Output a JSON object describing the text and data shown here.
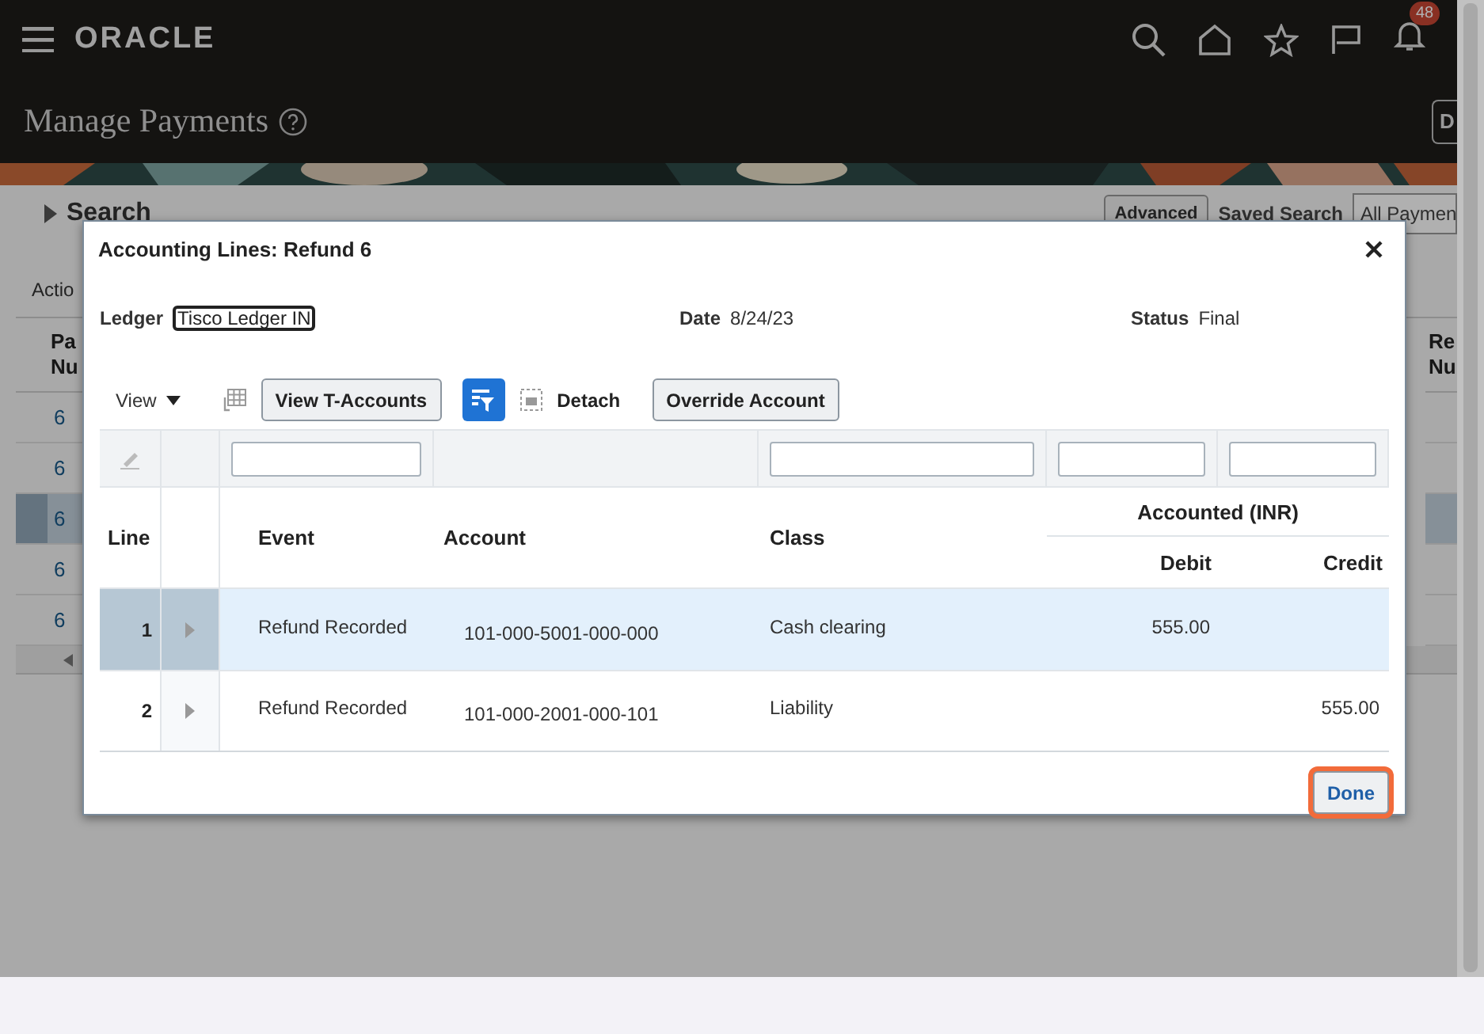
{
  "header": {
    "logo": "ORACLE",
    "notification_count": "48"
  },
  "page": {
    "title": "Manage Payments",
    "cut_button": "D",
    "search": {
      "label": "Search",
      "buttons": [
        "Advanced"
      ],
      "saved_search_label": "Saved Search",
      "saved_search_value": "All Paymen"
    },
    "actions_label": "Actio",
    "results": {
      "first_heading": [
        "Pa",
        "Nu"
      ],
      "last_heading": [
        "Re",
        "Nu"
      ],
      "rows": [
        {
          "value": "6",
          "selected": false
        },
        {
          "value": "6",
          "selected": false
        },
        {
          "value": "6",
          "selected": true
        },
        {
          "value": "6",
          "selected": false
        },
        {
          "value": "6",
          "selected": false
        }
      ]
    }
  },
  "dialog": {
    "title": "Accounting Lines: Refund 6",
    "fields": [
      {
        "label": "Ledger",
        "value": "Tisco Ledger IN",
        "kind": "link"
      },
      {
        "label": "Date",
        "value": "8/24/23",
        "kind": "text"
      },
      {
        "label": "Status",
        "value": "Final",
        "kind": "text"
      }
    ],
    "toolbar": [
      {
        "kind": "menu",
        "label": "View"
      },
      {
        "kind": "icon"
      },
      {
        "kind": "button",
        "label": "View T-Accounts"
      },
      {
        "kind": "toggle",
        "selected": true
      },
      {
        "kind": "icon-label",
        "label": "Detach"
      },
      {
        "kind": "button",
        "label": "Override Account"
      }
    ],
    "columns": [
      {
        "label": "Line",
        "filter": false
      },
      {
        "label": "Event",
        "filter": true
      },
      {
        "label": "Account",
        "filter": false
      },
      {
        "label": "Class",
        "filter": true
      }
    ],
    "amount_group": {
      "label": "Accounted (INR)",
      "columns": [
        {
          "label": "Debit",
          "filter": true
        },
        {
          "label": "Credit",
          "filter": true
        }
      ]
    },
    "rows": [
      {
        "line": "1",
        "event": "Refund Recorded",
        "account": "101-000-5001-000-000",
        "class": "Cash clearing",
        "debit": "555.00",
        "selected": true
      },
      {
        "line": "2",
        "event": "Refund Recorded",
        "account": "101-000-2001-000-101",
        "class": "Liability",
        "credit": "555.00",
        "selected": false
      }
    ],
    "done_button": "Done"
  }
}
